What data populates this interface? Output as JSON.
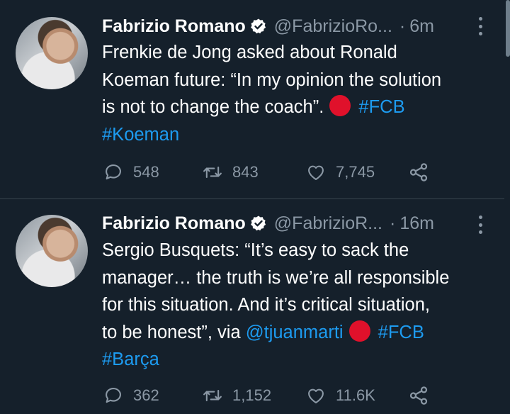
{
  "colors": {
    "background": "#15202b",
    "text": "#ffffff",
    "muted": "#8b98a5",
    "link": "#1d9bf0",
    "verified": "#ffffff",
    "red_circle": "#e0112b"
  },
  "tweets": [
    {
      "author_name": "Fabrizio Romano",
      "handle": "@FabrizioRo...",
      "separator": "·",
      "time": "6m",
      "lines": [
        {
          "text": "Frenkie de Jong asked about Ronald"
        },
        {
          "text": "Koeman future: “In my opinion the solution"
        },
        {
          "text": "is not to change the coach”.",
          "emoji": "red-circle",
          "link": "#FCB"
        },
        {
          "link": "#Koeman"
        }
      ],
      "replies": "548",
      "retweets": "843",
      "likes": "7,745"
    },
    {
      "author_name": "Fabrizio Romano",
      "handle": "@FabrizioR...",
      "separator": "·",
      "time": "16m",
      "lines": [
        {
          "text": "Sergio Busquets: “It’s easy to sack the"
        },
        {
          "text": "manager… the truth is we’re all responsible"
        },
        {
          "text": "for this situation. And it’s critical situation,"
        },
        {
          "text": "to be honest”, via ",
          "mention": "@tjuanmarti",
          "emoji": "red-circle",
          "link": "#FCB"
        },
        {
          "link": "#Barça"
        }
      ],
      "replies": "362",
      "retweets": "1,152",
      "likes": "11.6K"
    }
  ],
  "icons": [
    "verified-badge-icon",
    "more-options-icon",
    "reply-icon",
    "retweet-icon",
    "like-icon",
    "share-icon",
    "red-circle-emoji"
  ]
}
